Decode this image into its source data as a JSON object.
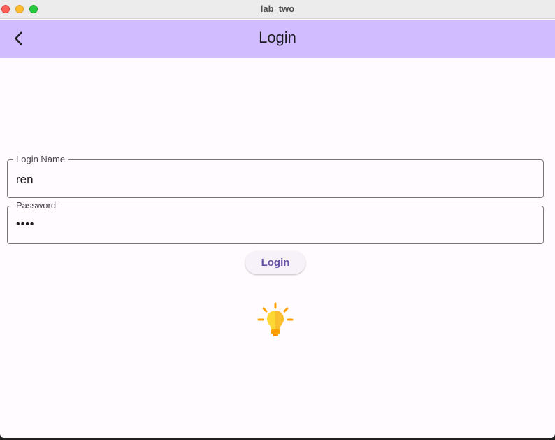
{
  "window": {
    "title": "lab_two",
    "controls": [
      "close",
      "minimize",
      "maximize"
    ]
  },
  "appbar": {
    "title": "Login",
    "back_icon": "chevron-left-icon",
    "background_color": "#d0bcff"
  },
  "form": {
    "login_name": {
      "label": "Login Name",
      "value": "ren"
    },
    "password": {
      "label": "Password",
      "value": "••••"
    },
    "submit_label": "Login"
  },
  "status_icon": "lightbulb-icon",
  "colors": {
    "accent": "#6750a4",
    "surface": "#fffbfe",
    "bulb": "#fdd835",
    "rays": "#ffa000"
  }
}
